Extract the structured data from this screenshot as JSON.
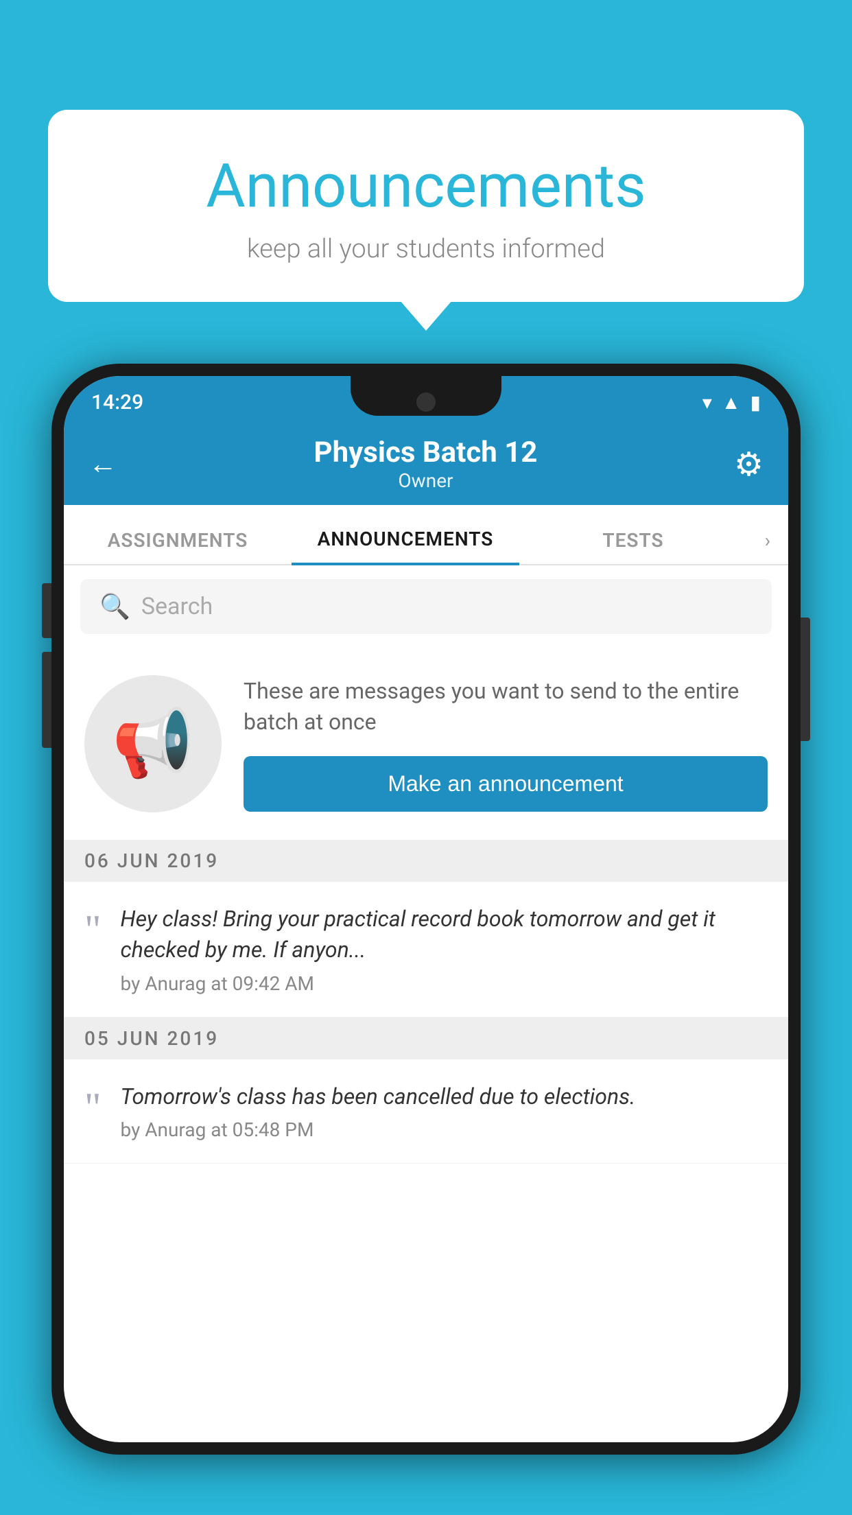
{
  "background_color": "#29b6d8",
  "speech_bubble": {
    "title": "Announcements",
    "subtitle": "keep all your students informed"
  },
  "status_bar": {
    "time": "14:29",
    "icons": [
      "wifi",
      "signal",
      "battery"
    ]
  },
  "app_header": {
    "title": "Physics Batch 12",
    "subtitle": "Owner",
    "back_label": "←",
    "gear_label": "⚙"
  },
  "tabs": [
    {
      "label": "ASSIGNMENTS",
      "active": false
    },
    {
      "label": "ANNOUNCEMENTS",
      "active": true
    },
    {
      "label": "TESTS",
      "active": false
    }
  ],
  "search": {
    "placeholder": "Search"
  },
  "announcement_info": {
    "description": "These are messages you want to send to the entire batch at once",
    "button_label": "Make an announcement"
  },
  "date_sections": [
    {
      "date": "06  JUN  2019",
      "items": [
        {
          "text": "Hey class! Bring your practical record book tomorrow and get it checked by me. If anyon...",
          "author": "by Anurag at 09:42 AM"
        }
      ]
    },
    {
      "date": "05  JUN  2019",
      "items": [
        {
          "text": "Tomorrow's class has been cancelled due to elections.",
          "author": "by Anurag at 05:48 PM"
        }
      ]
    }
  ]
}
